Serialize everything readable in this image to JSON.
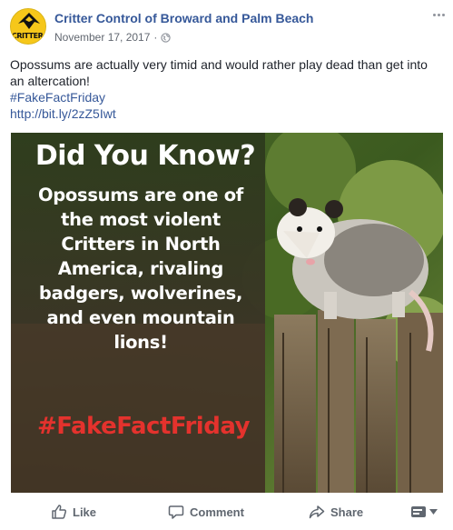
{
  "post": {
    "page_name": "Critter Control of Broward and Palm Beach",
    "date": "November 17, 2017",
    "separator": "·",
    "text_line1": "Opossums are actually very timid and would rather play dead than get into an altercation!",
    "hashtag": "#FakeFactFriday",
    "link": "http://bit.ly/2zZ5Iwt"
  },
  "avatar": {
    "logo_text": "CRITTER",
    "logo_text2": "CONTROL"
  },
  "image": {
    "title": "Did You Know?",
    "body": "Opossums are one of the most violent Critters in North America, rivaling badgers, wolverines, and even mountain lions!",
    "tag": "#FakeFactFriday"
  },
  "actions": {
    "like": "Like",
    "comment": "Comment",
    "share": "Share"
  },
  "colors": {
    "link": "#365899",
    "meta": "#616770",
    "action": "#606770",
    "tag_red": "#e4322d"
  }
}
